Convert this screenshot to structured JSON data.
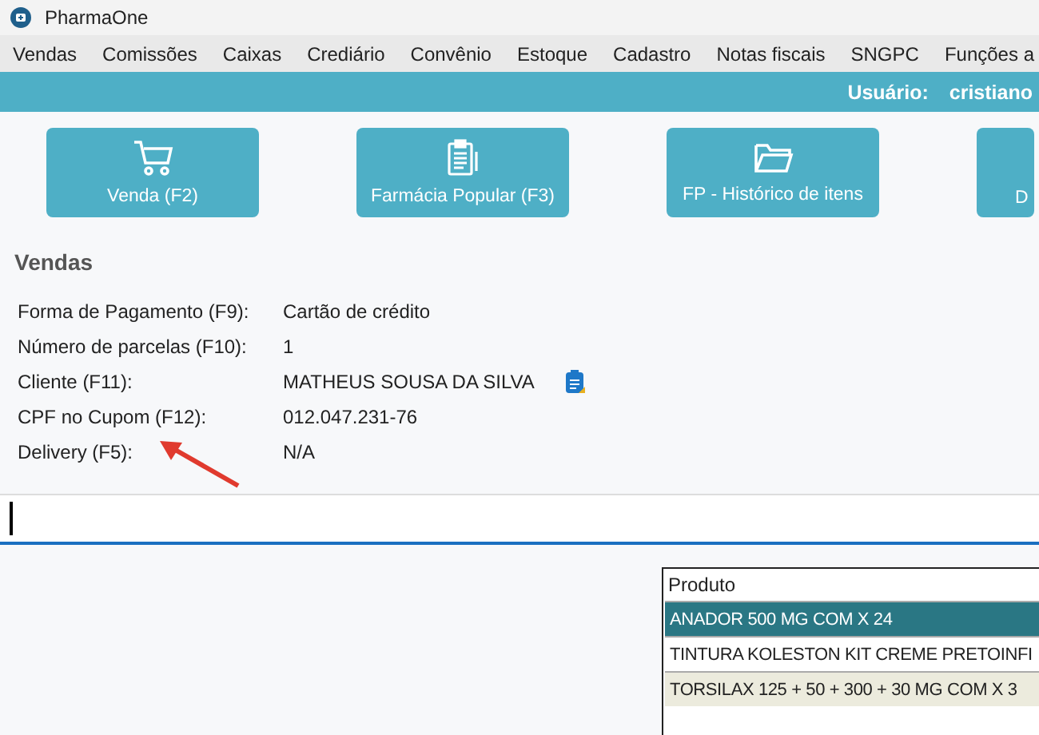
{
  "window": {
    "title": "PharmaOne"
  },
  "menu": [
    "Vendas",
    "Comissões",
    "Caixas",
    "Crediário",
    "Convênio",
    "Estoque",
    "Cadastro",
    "Notas fiscais",
    "SNGPC",
    "Funções a"
  ],
  "user_bar": {
    "label": "Usuário:",
    "value": "cristiano"
  },
  "actions": [
    {
      "label": "Venda (F2)",
      "kind": "cart"
    },
    {
      "label": "Farmácia Popular (F3)",
      "kind": "clipboard"
    },
    {
      "label": "FP - Histórico de itens",
      "kind": "folder"
    },
    {
      "label": "D",
      "kind": "plain"
    }
  ],
  "section_title": "Vendas",
  "fields": [
    {
      "label": "Forma de Pagamento (F9):",
      "value": "Cartão de crédito",
      "kind": "plain"
    },
    {
      "label": "Número de parcelas (F10):",
      "value": "1",
      "kind": "plain"
    },
    {
      "label": "Cliente (F11):",
      "value": "MATHEUS SOUSA DA SILVA",
      "kind": "lookup"
    },
    {
      "label": "CPF no Cupom (F12):",
      "value": "012.047.231-76",
      "kind": "plain"
    },
    {
      "label": "Delivery (F5):",
      "value": "N/A",
      "kind": "plain"
    }
  ],
  "table": {
    "columns": [
      "Produto"
    ],
    "rows": [
      {
        "cells": [
          "ANADOR 500 MG COM X 24"
        ],
        "selected": true
      },
      {
        "cells": [
          "TINTURA KOLESTON KIT CREME PRETOINFI"
        ],
        "selected": false
      },
      {
        "cells": [
          "TORSILAX 125 + 50 + 300 + 30 MG COM X 3"
        ],
        "selected": false
      }
    ]
  }
}
